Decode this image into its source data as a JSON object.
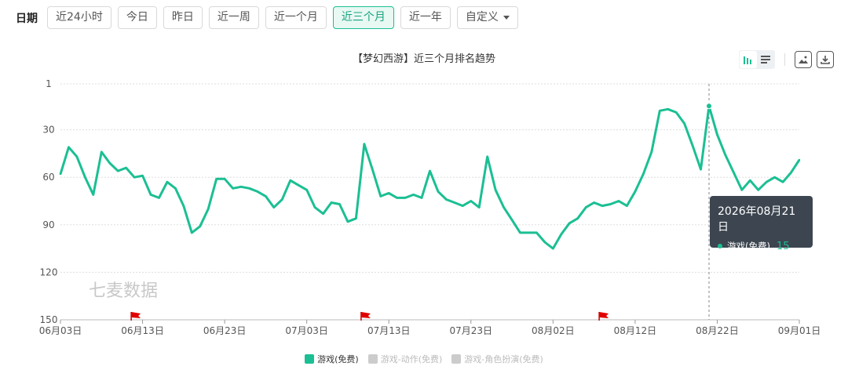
{
  "filter": {
    "label": "日期",
    "buttons": [
      "近24小时",
      "今日",
      "昨日",
      "近一周",
      "近一个月",
      "近三个月",
      "近一年",
      "自定义"
    ],
    "active_index": 5,
    "active_color": "#16a37e"
  },
  "chart_title": "【梦幻西游】近三个月排名趋势",
  "watermark": "七麦数据",
  "tooltip": {
    "date": "2026年08月21日",
    "series_name": "游戏(免费)",
    "value": "15"
  },
  "legend": [
    {
      "name": "游戏(免费)",
      "color": "#1bbf93",
      "active": true
    },
    {
      "name": "游戏-动作(免费)",
      "color": "#cccccc",
      "active": false
    },
    {
      "name": "游戏-角色扮演(免费)",
      "color": "#cccccc",
      "active": false
    }
  ],
  "icons": {
    "bar_chart": "bar-chart-icon",
    "list": "list-icon",
    "save_image": "image-icon",
    "download": "download-icon",
    "flag": "flag-icon"
  },
  "chart_data": {
    "type": "line",
    "title": "【梦幻西游】近三个月排名趋势",
    "xlabel": "",
    "ylabel": "",
    "y_inverted": true,
    "ylim": [
      1,
      150
    ],
    "y_ticks": [
      1,
      30,
      60,
      90,
      120,
      150
    ],
    "x_start_date": "2026-06-03",
    "x_end_date": "2026-09-01",
    "x_tick_labels": [
      "06月03日",
      "06月13日",
      "06月23日",
      "07月03日",
      "07月13日",
      "07月23日",
      "08月02日",
      "08月12日",
      "08月22日",
      "09月01日"
    ],
    "x_tick_dates": [
      "2026-06-03",
      "2026-06-13",
      "2026-06-23",
      "2026-07-03",
      "2026-07-13",
      "2026-07-23",
      "2026-08-02",
      "2026-08-12",
      "2026-08-22",
      "2026-09-01"
    ],
    "grid": true,
    "legend_position": "bottom",
    "series": [
      {
        "name": "游戏(免费)",
        "color": "#1bbf93",
        "dates": [
          "2026-06-03",
          "2026-06-04",
          "2026-06-05",
          "2026-06-06",
          "2026-06-07",
          "2026-06-08",
          "2026-06-09",
          "2026-06-10",
          "2026-06-11",
          "2026-06-12",
          "2026-06-13",
          "2026-06-14",
          "2026-06-15",
          "2026-06-16",
          "2026-06-17",
          "2026-06-18",
          "2026-06-19",
          "2026-06-20",
          "2026-06-21",
          "2026-06-22",
          "2026-06-23",
          "2026-06-24",
          "2026-06-25",
          "2026-06-26",
          "2026-06-27",
          "2026-06-28",
          "2026-06-29",
          "2026-06-30",
          "2026-07-01",
          "2026-07-02",
          "2026-07-03",
          "2026-07-04",
          "2026-07-05",
          "2026-07-06",
          "2026-07-07",
          "2026-07-08",
          "2026-07-09",
          "2026-07-10",
          "2026-07-11",
          "2026-07-12",
          "2026-07-13",
          "2026-07-14",
          "2026-07-15",
          "2026-07-16",
          "2026-07-17",
          "2026-07-18",
          "2026-07-19",
          "2026-07-20",
          "2026-07-21",
          "2026-07-22",
          "2026-07-23",
          "2026-07-24",
          "2026-07-25",
          "2026-07-26",
          "2026-07-27",
          "2026-07-28",
          "2026-07-29",
          "2026-07-30",
          "2026-07-31",
          "2026-08-01",
          "2026-08-02",
          "2026-08-03",
          "2026-08-04",
          "2026-08-05",
          "2026-08-06",
          "2026-08-07",
          "2026-08-08",
          "2026-08-09",
          "2026-08-10",
          "2026-08-11",
          "2026-08-12",
          "2026-08-13",
          "2026-08-14",
          "2026-08-15",
          "2026-08-16",
          "2026-08-17",
          "2026-08-18",
          "2026-08-19",
          "2026-08-20",
          "2026-08-21",
          "2026-08-22",
          "2026-08-23",
          "2026-08-24",
          "2026-08-25",
          "2026-08-26",
          "2026-08-27",
          "2026-08-28",
          "2026-08-29",
          "2026-08-30",
          "2026-08-31",
          "2026-09-01"
        ],
        "values": [
          58,
          41,
          47,
          60,
          71,
          44,
          51,
          56,
          54,
          60,
          59,
          71,
          73,
          63,
          67,
          78,
          95,
          91,
          80,
          61,
          61,
          67,
          66,
          67,
          69,
          72,
          79,
          74,
          62,
          65,
          68,
          79,
          83,
          76,
          77,
          88,
          86,
          39,
          55,
          72,
          70,
          73,
          73,
          71,
          73,
          56,
          69,
          74,
          76,
          78,
          75,
          79,
          47,
          68,
          79,
          87,
          95,
          95,
          95,
          101,
          105,
          96,
          89,
          86,
          79,
          76,
          78,
          77,
          75,
          78,
          69,
          58,
          44,
          18,
          17,
          19,
          26,
          40,
          55,
          15,
          33,
          46,
          57,
          68,
          62,
          68,
          63,
          60,
          63,
          57,
          49,
          45,
          43
        ]
      }
    ],
    "markers": [
      {
        "type": "flag",
        "date": "2026-06-12"
      },
      {
        "type": "flag",
        "date": "2026-07-10"
      },
      {
        "type": "flag",
        "date": "2026-08-08"
      }
    ],
    "highlight": {
      "date": "2026-08-21",
      "value": 15
    }
  }
}
